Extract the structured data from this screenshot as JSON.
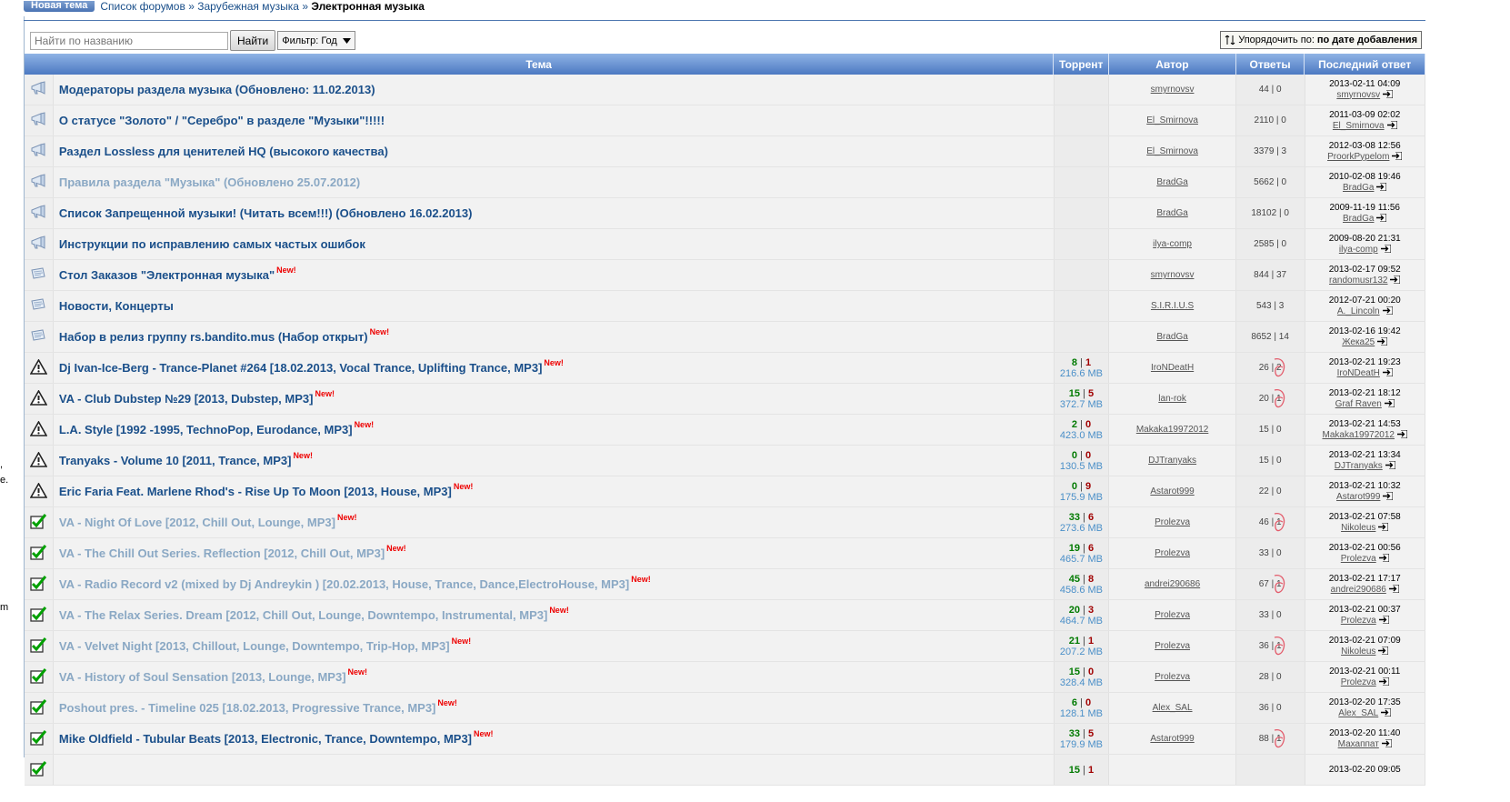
{
  "top": {
    "new_topic_label": "Новая тема",
    "crumb_1": "Список форумов",
    "crumb_sep": "»",
    "crumb_2": "Зарубежная музыка",
    "crumb_3": "Электронная музыка"
  },
  "toolbar": {
    "search_placeholder": "Найти по названию",
    "find_label": "Найти",
    "filter_label": "Фильтр: Год",
    "sort_prefix": "Упорядочить по:",
    "sort_value": "по дате добавления"
  },
  "left_fragments": [
    ",",
    "e.",
    "m"
  ],
  "columns": {
    "topic": "Тема",
    "torrent": "Торрент",
    "author": "Автор",
    "answers": "Ответы",
    "last": "Последний ответ"
  },
  "new_label": "New!",
  "rows": [
    {
      "icon": "announce",
      "title": "Модераторы раздела музыка (Обновлено: 11.02.2013)",
      "visited": false,
      "new": false,
      "seeds": "",
      "leech": "",
      "size": "",
      "author": "smyrnovsv",
      "answers": "44 | 0",
      "last_date": "2013-02-11 04:09",
      "last_user": "smyrnovsv"
    },
    {
      "icon": "announce",
      "title": "О статусе \"Золото\" / \"Серебро\" в разделе \"Музыки\"!!!!!",
      "visited": false,
      "new": false,
      "seeds": "",
      "leech": "",
      "size": "",
      "author": "El_Smirnova",
      "answers": "2110 | 0",
      "last_date": "2011-03-09 02:02",
      "last_user": "El_Smirnova"
    },
    {
      "icon": "announce",
      "title": "Раздел Lossless для ценителей HQ (высокого качества)",
      "visited": false,
      "new": false,
      "seeds": "",
      "leech": "",
      "size": "",
      "author": "El_Smirnova",
      "answers": "3379 | 3",
      "last_date": "2012-03-08 12:56",
      "last_user": "ProorkPypelom"
    },
    {
      "icon": "announce",
      "title": "Правила раздела \"Музыка\" (Обновлено 25.07.2012)",
      "visited": true,
      "new": false,
      "seeds": "",
      "leech": "",
      "size": "",
      "author": "BradGa",
      "answers": "5662 | 0",
      "last_date": "2010-02-08 19:46",
      "last_user": "BradGa"
    },
    {
      "icon": "announce",
      "title": "Список Запрещенной музыки! (Читать всем!!!) (Обновлено 16.02.2013)",
      "visited": false,
      "new": false,
      "seeds": "",
      "leech": "",
      "size": "",
      "author": "BradGa",
      "answers": "18102 | 0",
      "last_date": "2009-11-19 11:56",
      "last_user": "BradGa"
    },
    {
      "icon": "announce",
      "title": "Инструкции по исправлению самых частых ошибок",
      "visited": false,
      "new": false,
      "seeds": "",
      "leech": "",
      "size": "",
      "author": "ilya-comp",
      "answers": "2585 | 0",
      "last_date": "2009-08-20 21:31",
      "last_user": "ilya-comp"
    },
    {
      "icon": "sticky",
      "title": "Стол Заказов \"Электронная музыка\"",
      "visited": false,
      "new": true,
      "seeds": "",
      "leech": "",
      "size": "",
      "author": "smyrnovsv",
      "answers": "844 | 37",
      "last_date": "2013-02-17 09:52",
      "last_user": "randomusr132"
    },
    {
      "icon": "sticky",
      "title": "Новости, Концерты",
      "visited": false,
      "new": false,
      "seeds": "",
      "leech": "",
      "size": "",
      "author": "S.I.R.I.U.S",
      "answers": "543 | 3",
      "last_date": "2012-07-21 00:20",
      "last_user": "A._Lincoln"
    },
    {
      "icon": "sticky",
      "title": "Набор в релиз группу rs.bandito.mus (Набор открыт)",
      "visited": false,
      "new": true,
      "seeds": "",
      "leech": "",
      "size": "",
      "author": "BradGa",
      "answers": "8652 | 14",
      "last_date": "2013-02-16 19:42",
      "last_user": "Жека25"
    },
    {
      "icon": "warning",
      "title": "Dj Ivan-Ice-Berg - Trance-Planet #264 [18.02.2013, Vocal Trance, Uplifting Trance, MP3]",
      "visited": false,
      "new": true,
      "seeds": "8",
      "leech": "1",
      "size": "216.6 MB",
      "author": "IroNDeatH",
      "answers": "26 | 2",
      "last_date": "2013-02-21 19:23",
      "last_user": "IroNDeatH",
      "marked": true
    },
    {
      "icon": "warning",
      "title": "VA - Club Dubstep №29 [2013, Dubstep, MP3]",
      "visited": false,
      "new": true,
      "seeds": "15",
      "leech": "5",
      "size": "372.7 MB",
      "author": "lan-rok",
      "answers": "20 | 1",
      "last_date": "2013-02-21 18:12",
      "last_user": "Graf Raven",
      "marked": true
    },
    {
      "icon": "warning",
      "title": "L.A. Style [1992 -1995, TechnoPop, Eurodance, MP3]",
      "visited": false,
      "new": true,
      "seeds": "2",
      "leech": "0",
      "size": "423.0 MB",
      "author": "Makaka19972012",
      "answers": "15 | 0",
      "last_date": "2013-02-21 14:53",
      "last_user": "Makaka19972012"
    },
    {
      "icon": "warning",
      "title": "Tranyaks - Volume 10 [2011, Trance, MP3]",
      "visited": false,
      "new": true,
      "seeds": "0",
      "leech": "0",
      "size": "130.5 MB",
      "author": "DJTranyaks",
      "answers": "15 | 0",
      "last_date": "2013-02-21 13:34",
      "last_user": "DJTranyaks"
    },
    {
      "icon": "warning",
      "title": "Eric Faria Feat. Marlene Rhod's - Rise Up To Moon [2013, House, MP3]",
      "visited": false,
      "new": true,
      "seeds": "0",
      "leech": "9",
      "size": "175.9 MB",
      "author": "Astarot999",
      "answers": "22 | 0",
      "last_date": "2013-02-21 10:32",
      "last_user": "Astarot999"
    },
    {
      "icon": "check",
      "title": "VA - Night Of Love [2012, Chill Out, Lounge, MP3]",
      "visited": true,
      "new": true,
      "seeds": "33",
      "leech": "6",
      "size": "273.6 MB",
      "author": "Prolezva",
      "answers": "46 | 1",
      "last_date": "2013-02-21 07:58",
      "last_user": "Nikoleus",
      "marked": true
    },
    {
      "icon": "check",
      "title": "VA - The Chill Out Series. Reflection [2012, Chill Out, MP3]",
      "visited": true,
      "new": true,
      "seeds": "19",
      "leech": "6",
      "size": "465.7 MB",
      "author": "Prolezva",
      "answers": "33 | 0",
      "last_date": "2013-02-21 00:56",
      "last_user": "Prolezva"
    },
    {
      "icon": "check",
      "title": "VA - Radio Record v2 (mixed by Dj Andreykin ) [20.02.2013, House, Trance, Dance,ElectroHouse, MP3]",
      "visited": true,
      "new": true,
      "seeds": "45",
      "leech": "8",
      "size": "458.6 MB",
      "author": "andrei290686",
      "answers": "67 | 1",
      "last_date": "2013-02-21 17:17",
      "last_user": "andrei290686",
      "marked": true
    },
    {
      "icon": "check",
      "title": "VA - The Relax Series. Dream [2012, Chill Out, Lounge, Downtempo, Instrumental, MP3]",
      "visited": true,
      "new": true,
      "seeds": "20",
      "leech": "3",
      "size": "464.7 MB",
      "author": "Prolezva",
      "answers": "33 | 0",
      "last_date": "2013-02-21 00:37",
      "last_user": "Prolezva"
    },
    {
      "icon": "check",
      "title": "VA - Velvet Night [2013, Chillout, Lounge, Downtempo, Trip-Hop, MP3]",
      "visited": true,
      "new": true,
      "seeds": "21",
      "leech": "1",
      "size": "207.2 MB",
      "author": "Prolezva",
      "answers": "36 | 1",
      "last_date": "2013-02-21 07:09",
      "last_user": "Nikoleus",
      "marked": true
    },
    {
      "icon": "check",
      "title": "VA - History of Soul Sensation [2013, Lounge, MP3]",
      "visited": true,
      "new": true,
      "seeds": "15",
      "leech": "0",
      "size": "328.4 MB",
      "author": "Prolezva",
      "answers": "28 | 0",
      "last_date": "2013-02-21 00:11",
      "last_user": "Prolezva"
    },
    {
      "icon": "check",
      "title": "Poshout pres. - Timeline 025 [18.02.2013, Progressive Trance, MP3]",
      "visited": true,
      "new": true,
      "seeds": "6",
      "leech": "0",
      "size": "128.1 MB",
      "author": "Alex_SAL",
      "answers": "36 | 0",
      "last_date": "2013-02-20 17:35",
      "last_user": "Alex_SAL"
    },
    {
      "icon": "check",
      "title": "Mike Oldfield - Tubular Beats [2013, Electronic, Trance, Downtempo, MP3]",
      "visited": false,
      "new": true,
      "seeds": "33",
      "leech": "5",
      "size": "179.9 MB",
      "author": "Astarot999",
      "answers": "88 | 1",
      "last_date": "2013-02-20 11:40",
      "last_user": "Махаппат",
      "marked": true
    },
    {
      "icon": "check",
      "title": "",
      "visited": false,
      "new": false,
      "seeds": "15",
      "leech": "1",
      "size": "",
      "author": "",
      "answers": "",
      "last_date": "2013-02-20 09:05",
      "last_user": ""
    }
  ]
}
